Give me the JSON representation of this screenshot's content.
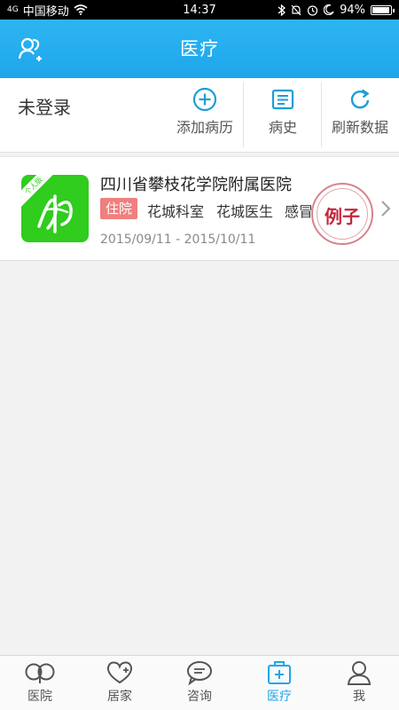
{
  "status_bar": {
    "signal": "4G",
    "carrier": "中国移动",
    "time": "14:37",
    "battery": "94%",
    "battery_level": 0.94
  },
  "header": {
    "title": "医疗",
    "icons": {
      "left": "user-group-icon"
    }
  },
  "toolbar": {
    "login_status": "未登录",
    "actions": [
      {
        "label": "添加病历",
        "icon": "plus-circle-icon"
      },
      {
        "label": "病史",
        "icon": "document-icon"
      },
      {
        "label": "刷新数据",
        "icon": "refresh-icon"
      }
    ]
  },
  "records": [
    {
      "hospital": "四川省攀枝花学院附属医院",
      "type_tag": "住院",
      "department": "花城科室",
      "doctor": "花城医生",
      "diagnosis": "感冒",
      "date_range": "2015/09/11 - 2015/10/11",
      "stamp": "例子",
      "logo_badge": "个人版"
    }
  ],
  "tabs": [
    {
      "label": "医院",
      "icon": "hospital-icon",
      "active": false
    },
    {
      "label": "居家",
      "icon": "heart-plus-icon",
      "active": false
    },
    {
      "label": "咨询",
      "icon": "chat-icon",
      "active": false
    },
    {
      "label": "医疗",
      "icon": "medical-kit-icon",
      "active": true
    },
    {
      "label": "我",
      "icon": "person-icon",
      "active": false
    }
  ],
  "colors": {
    "header": "#1ea6ec",
    "accent": "#1ea6ec",
    "tag": "#f07f7f",
    "stamp": "#c2273a",
    "logo": "#30cc1e"
  }
}
